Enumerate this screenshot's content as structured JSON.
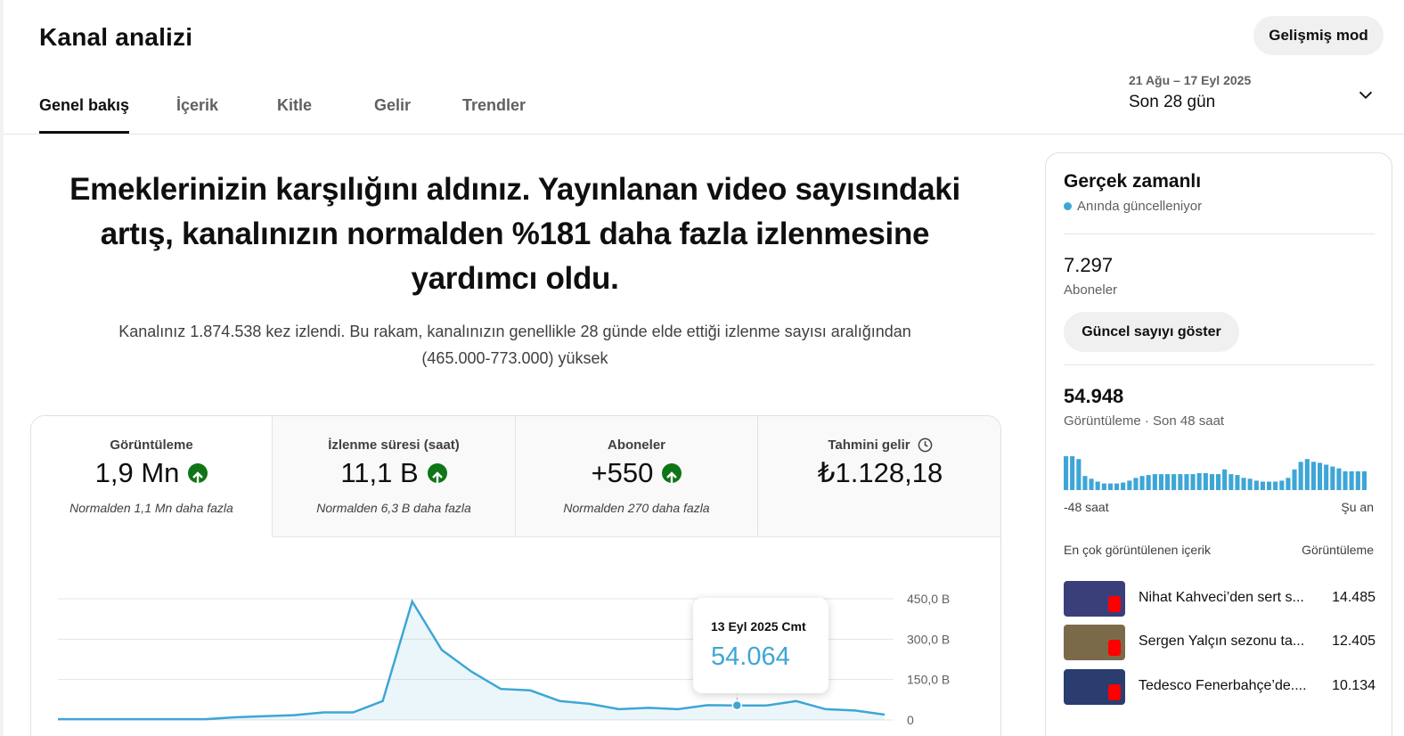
{
  "header": {
    "title": "Kanal analizi",
    "advanced_mode_label": "Gelişmiş mod",
    "tabs": [
      {
        "label": "Genel bakış",
        "active": true
      },
      {
        "label": "İçerik",
        "active": false
      },
      {
        "label": "Kitle",
        "active": false
      },
      {
        "label": "Gelir",
        "active": false
      },
      {
        "label": "Trendler",
        "active": false
      }
    ],
    "date_range": "21 Ağu – 17 Eyl 2025",
    "date_label": "Son 28 gün",
    "date_icon": "chevron-down-icon"
  },
  "summary": {
    "headline": "Emeklerinizin karşılığını aldınız. Yayınlanan video sayısındaki artış, kanalınızın normalden %181 daha fazla izlenmesine yardımcı oldu.",
    "subtext": "Kanalınız 1.874.538 kez izlendi. Bu rakam, kanalınızın genellikle 28 günde elde ettiği izlenme sayısı aralığından (465.000-773.000) yüksek"
  },
  "metrics": [
    {
      "label": "Görüntüleme",
      "value": "1,9 Mn",
      "note": "Normalden 1,1 Mn daha fazla",
      "icon": "arrow-up-icon"
    },
    {
      "label": "İzlenme süresi (saat)",
      "value": "11,1 B",
      "note": "Normalden 6,3 B daha fazla",
      "icon": "arrow-up-icon"
    },
    {
      "label": "Aboneler",
      "value": "+550",
      "note": "Normalden 270 daha fazla",
      "icon": "arrow-up-icon"
    },
    {
      "label": "Tahmini gelir",
      "value": "₺1.128,18",
      "note": "",
      "icon": "clock-icon"
    }
  ],
  "chart_data": {
    "type": "area",
    "y_ticks": [
      "450,0 B",
      "300,0 B",
      "150,0 B",
      "0"
    ],
    "ylim": [
      0,
      450000
    ],
    "values": [
      3000,
      3000,
      3000,
      3000,
      3000,
      3000,
      10000,
      14000,
      18000,
      28000,
      28000,
      70000,
      440000,
      260000,
      180000,
      115000,
      110000,
      70000,
      60000,
      40000,
      45000,
      40000,
      55000,
      54064,
      54064,
      70000,
      40000,
      35000,
      20000
    ],
    "highlight_index": 23,
    "tooltip": {
      "date": "13 Eyl 2025 Cmt",
      "value": "54.064"
    },
    "accent": "#3ea6d6"
  },
  "realtime": {
    "title": "Gerçek zamanlı",
    "subtitle": "Anında güncelleniyor",
    "subscribers_value": "7.297",
    "subscribers_label": "Aboneler",
    "show_count_label": "Güncel sayıyı göster",
    "views_value": "54.948",
    "views_label": "Görüntüleme · Son 48 saat",
    "bars": [
      36,
      36,
      33,
      15,
      12,
      9,
      7,
      7,
      7,
      8,
      10,
      13,
      15,
      16,
      17,
      17,
      17,
      17,
      17,
      17,
      17,
      18,
      18,
      17,
      17,
      22,
      17,
      16,
      13,
      12,
      10,
      9,
      9,
      9,
      10,
      13,
      22,
      30,
      33,
      30,
      29,
      27,
      25,
      23,
      20,
      20,
      20,
      20
    ],
    "axis_left": "-48 saat",
    "axis_right": "Şu an",
    "top_content_header": "En çok görüntülenen içerik",
    "top_views_header": "Görüntüleme",
    "top_items": [
      {
        "title": "Nihat Kahveci’den sert s...",
        "views": "14.485",
        "thumb_color": "#3a3f7a"
      },
      {
        "title": "Sergen Yalçın sezonu ta...",
        "views": "12.405",
        "thumb_color": "#7b6a4a"
      },
      {
        "title": "Tedesco Fenerbahçe’de....",
        "views": "10.134",
        "thumb_color": "#2a3d6e"
      }
    ]
  }
}
